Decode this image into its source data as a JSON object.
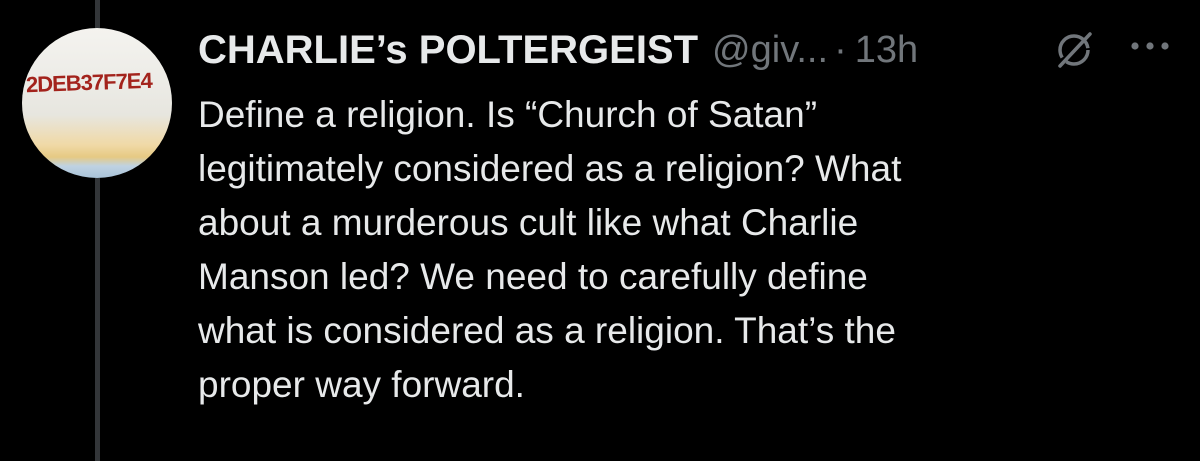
{
  "tweet": {
    "author": {
      "display_name": "CHARLIE’s POLTERGEIST",
      "handle": "@giv...",
      "avatar_text": "2DEB37F7E4"
    },
    "separator": "·",
    "time": "13h",
    "text_lines": [
      "Define a religion. Is “Church of Satan”",
      "legitimately considered as a religion? What",
      "about a murderous cult like what Charlie",
      "Manson led? We need to carefully define",
      "what is considered as a religion. That’s the",
      "proper way forward."
    ],
    "icons": {
      "grok": "grok-icon",
      "more": "more-options-icon"
    }
  },
  "colors": {
    "background": "#000000",
    "text_primary": "#e7e9ea",
    "text_secondary": "#71767b",
    "thread_line": "#333639"
  }
}
